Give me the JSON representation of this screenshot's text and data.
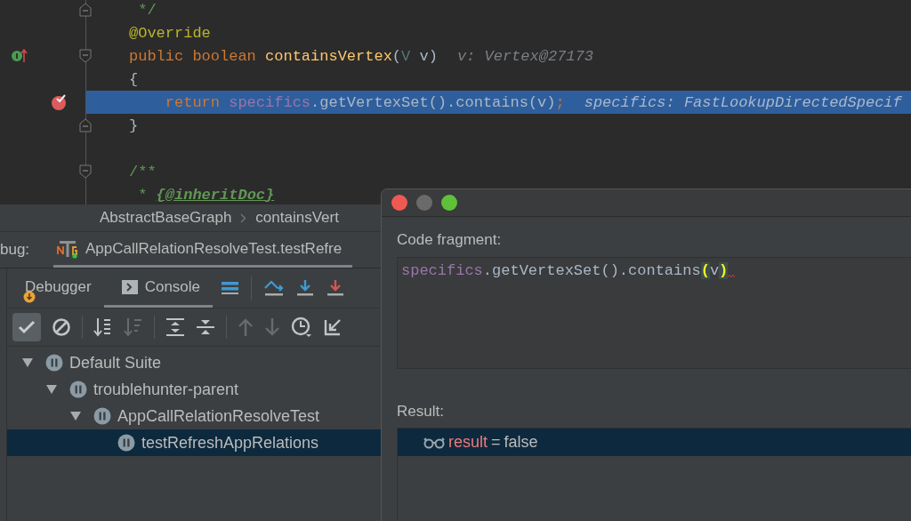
{
  "editor": {
    "lines": [
      {
        "kind": "code",
        "current": false,
        "fold_end": true,
        "tokens": [
          {
            "kind": "doc",
            "text": " */"
          }
        ]
      },
      {
        "kind": "code",
        "current": false,
        "tokens": [
          {
            "kind": "annotation",
            "text": "@Override"
          }
        ]
      },
      {
        "kind": "code",
        "current": false,
        "fold_start": true,
        "implements_marker": true,
        "tokens": [
          {
            "kind": "keyword",
            "text": "public boolean "
          },
          {
            "kind": "method",
            "text": "containsVertex"
          },
          {
            "kind": "plain",
            "text": "("
          },
          {
            "kind": "type-param",
            "text": "V"
          },
          {
            "kind": "plain",
            "text": " v)"
          }
        ],
        "hint": "v: Vertex@27173"
      },
      {
        "kind": "code",
        "current": false,
        "tokens": [
          {
            "kind": "plain",
            "text": "{"
          }
        ]
      },
      {
        "kind": "code",
        "current": true,
        "breakpoint": true,
        "tokens": [
          {
            "kind": "keyword",
            "text": "    return "
          },
          {
            "kind": "field",
            "text": "specifics"
          },
          {
            "kind": "plain",
            "text": ".getVertexSet().contains(v)"
          },
          {
            "kind": "keyword",
            "text": ";"
          }
        ],
        "hint": "specifics: FastLookupDirectedSpecif"
      },
      {
        "kind": "code",
        "current": false,
        "fold_end": true,
        "tokens": [
          {
            "kind": "plain",
            "text": "}"
          }
        ]
      },
      {
        "kind": "blank"
      },
      {
        "kind": "code",
        "current": false,
        "fold_start": true,
        "tokens": [
          {
            "kind": "doc",
            "text": "/**"
          }
        ]
      },
      {
        "kind": "code",
        "current": false,
        "tokens": [
          {
            "kind": "doc",
            "text": " * "
          },
          {
            "kind": "doc-tag",
            "text": "{@inheritDoc}"
          }
        ]
      }
    ]
  },
  "breadcrumbs": [
    {
      "label": "AbstractBaseGraph"
    },
    {
      "label": "containsVert"
    }
  ],
  "debug_bar": {
    "label": "bug:",
    "session_tab": {
      "label": "AppCallRelationResolveTest.testRefre",
      "selected": true
    }
  },
  "debugger_tabs": [
    {
      "label": "Debugger",
      "selected": false
    },
    {
      "label": "Console",
      "selected": true
    }
  ],
  "test_toolbar": {
    "show_passed_checked": true
  },
  "test_tree": [
    {
      "label": "Default Suite",
      "expanded": true,
      "selected": false,
      "children": [
        {
          "label": "troublehunter-parent",
          "expanded": true,
          "selected": false,
          "children": [
            {
              "label": "AppCallRelationResolveTest",
              "expanded": true,
              "selected": false,
              "children": [
                {
                  "label": "testRefreshAppRelations",
                  "selected": true
                }
              ]
            }
          ]
        }
      ]
    }
  ],
  "dialog": {
    "fragment_label": "Code fragment:",
    "fragment_tokens": [
      {
        "kind": "field",
        "text": "specifics"
      },
      {
        "kind": "plain",
        "text": ".getVertexSet().contains"
      },
      {
        "kind": "brace-match",
        "text": "("
      },
      {
        "kind": "plain",
        "text": "v"
      },
      {
        "kind": "brace-match",
        "text": ")"
      }
    ],
    "result_label": "Result:",
    "result": {
      "name": "result",
      "operator": "=",
      "value": "false",
      "selected": true
    }
  }
}
